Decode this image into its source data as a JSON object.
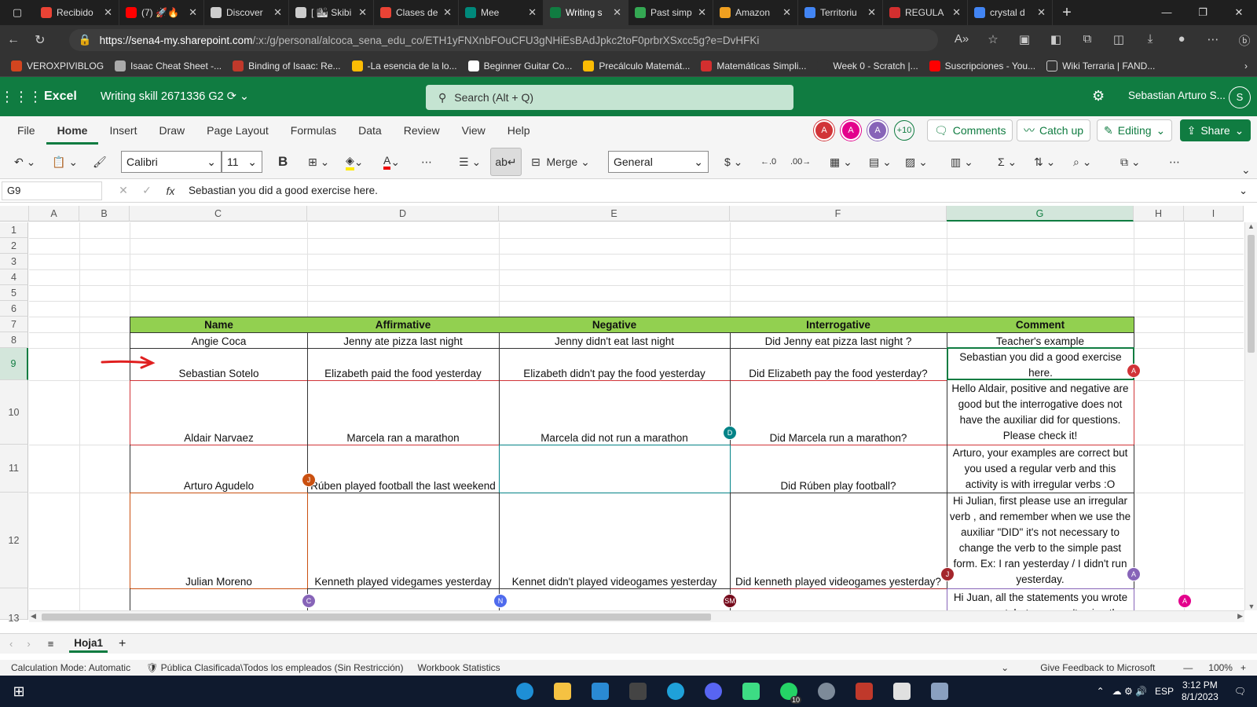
{
  "browser": {
    "tabs": [
      {
        "label": "Recibido",
        "color": "#ea4335"
      },
      {
        "label": "(7) 🚀🔥",
        "color": "#ff0000"
      },
      {
        "label": "Discover",
        "color": "#cccccc"
      },
      {
        "label": "[ 🏙 Skibi",
        "color": "#cccccc"
      },
      {
        "label": "Clases de",
        "color": "#ea4335"
      },
      {
        "label": "Mee",
        "color": "#00897b"
      },
      {
        "label": "Writing s",
        "color": "#107c41"
      },
      {
        "label": "Past simp",
        "color": "#34a853"
      },
      {
        "label": "Amazon",
        "color": "#f0a020"
      },
      {
        "label": "Territoriu",
        "color": "#4285f4"
      },
      {
        "label": "REGULA",
        "color": "#d32f2f"
      },
      {
        "label": "crystal d",
        "color": "#4285f4"
      }
    ],
    "url_host": "https://sena4-my.sharepoint.com",
    "url_path": "/:x:/g/personal/alcoca_sena_edu_co/ETH1yFNXnbFOuCFU3gNHiEsBAdJpkc2toF0prbrXSxcc5g?e=DvHFKi",
    "bookmarks": [
      "VEROXPIVIBLOG",
      "Isaac Cheat Sheet -...",
      "Binding of Isaac: Re...",
      "-La esencia de la lo...",
      "Beginner Guitar Co...",
      "Precálculo Matemát...",
      "Matemáticas Simpli...",
      "Week 0 - Scratch |...",
      "Suscripciones - You...",
      "Wiki Terraria | FAND..."
    ]
  },
  "excel": {
    "app_name": "Excel",
    "doc_name": "Writing skill 2671336 G2",
    "search_placeholder": "Search (Alt + Q)",
    "user_name": "Sebastian Arturo S...",
    "user_initial": "S",
    "ribbon_tabs": [
      "File",
      "Home",
      "Insert",
      "Draw",
      "Page Layout",
      "Formulas",
      "Data",
      "Review",
      "View",
      "Help"
    ],
    "collaborators": [
      {
        "initial": "A",
        "color": "#d13438"
      },
      {
        "initial": "A",
        "color": "#e3008c"
      },
      {
        "initial": "A",
        "color": "#8764b8"
      }
    ],
    "more_collaborators": "+10",
    "comments_label": "Comments",
    "catchup_label": "Catch up",
    "editing_label": "Editing",
    "share_label": "Share",
    "font_name": "Calibri",
    "font_size": "11",
    "merge_label": "Merge",
    "number_format": "General",
    "name_box": "G9",
    "formula_text": "Sebastian you did a good exercise here."
  },
  "sheet": {
    "columns": [
      "A",
      "B",
      "C",
      "D",
      "E",
      "F",
      "G",
      "H",
      "I"
    ],
    "rows": [
      "1",
      "2",
      "3",
      "4",
      "5",
      "6",
      "7",
      "8",
      "9",
      "10",
      "11",
      "12",
      "13"
    ],
    "header": [
      "Name",
      "Affirmative",
      "Negative",
      "Interrogative",
      "Comment"
    ],
    "data": [
      [
        "Angie Coca",
        "Jenny ate pizza last night",
        "Jenny didn't eat last night",
        "Did Jenny eat pizza last night ?",
        "Teacher's example"
      ],
      [
        "Sebastian Sotelo",
        "Elizabeth paid the food yesterday",
        "Elizabeth didn't pay the food yesterday",
        "Did Elizabeth pay the food yesterday?",
        "Sebastian you did a good exercise here."
      ],
      [
        "Aldair Narvaez",
        "Marcela ran a marathon",
        "Marcela did not run a marathon",
        "Did Marcela run a marathon?",
        "Hello Aldair, positive and negative are good but the interrogative does not have the auxiliar did for questions. Please check it!"
      ],
      [
        "Arturo Agudelo",
        "Rúben played football the last weekend",
        "",
        "Did Rúben play football?",
        "Arturo, your examples are correct but you used a regular verb and this activity is with irregular verbs :O"
      ],
      [
        "Julian Moreno",
        "Kenneth played videgames yesterday",
        "Kennet didn't played videogames yesterday",
        "Did kenneth played videogames yesterday?",
        "Hi Julian, first please use an irregular verb , and remember when we use the auxiliar \"DID\" it's not necessary to change the verb to the simple past form. Ex: I ran yesterday / I didn't run yesterday."
      ],
      [
        "",
        "",
        "",
        "",
        "Hi Juan, all the statements you wrote are correct, but you aren't using the"
      ]
    ],
    "presence": [
      {
        "initial": "A",
        "color": "#d13438"
      },
      {
        "initial": "D",
        "color": "#038387"
      },
      {
        "initial": "J",
        "color": "#ca5010"
      },
      {
        "initial": "J",
        "color": "#a4262c"
      },
      {
        "initial": "A",
        "color": "#8764b8"
      },
      {
        "initial": "C",
        "color": "#8764b8"
      },
      {
        "initial": "N",
        "color": "#4f6bed"
      },
      {
        "initial": "SM",
        "color": "#750b1c"
      },
      {
        "initial": "A",
        "color": "#e3008c"
      }
    ],
    "sheet_tab": "Hoja1"
  },
  "status": {
    "calc_mode": "Calculation Mode: Automatic",
    "sensitivity": "Pública Clasificada\\Todos los empleados (Sin Restricción)",
    "workbook_stats": "Workbook Statistics",
    "feedback": "Give Feedback to Microsoft",
    "zoom": "100%"
  },
  "taskbar": {
    "lang": "ESP",
    "time": "3:12 PM",
    "date": "8/1/2023",
    "whatsapp_badge": "10"
  }
}
